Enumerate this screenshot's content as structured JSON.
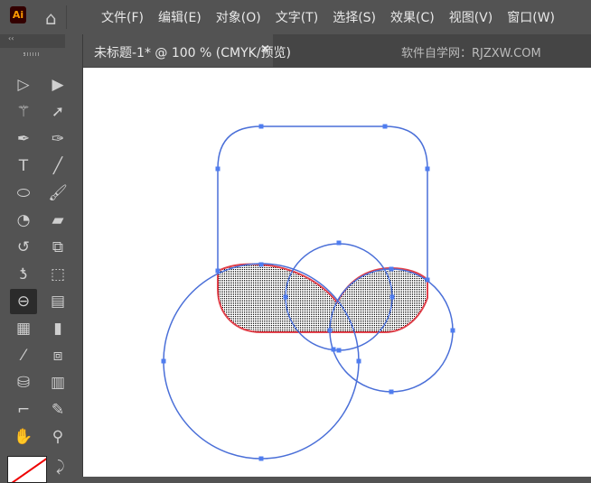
{
  "app": {
    "logo": "Ai",
    "home_icon": "home-icon"
  },
  "menus": [
    "文件(F)",
    "编辑(E)",
    "对象(O)",
    "文字(T)",
    "选择(S)",
    "效果(C)",
    "视图(V)",
    "窗口(W)"
  ],
  "document_tab": {
    "title": "未标题-1* @ 100 % (CMYK/预览)",
    "close": "×"
  },
  "watermark": "软件自学网：RJZXW.COM",
  "toolbar": {
    "collapse": "‹‹",
    "tools": [
      {
        "name": "selection-tool",
        "glyph": "▷"
      },
      {
        "name": "direct-selection-tool",
        "glyph": "▶"
      },
      {
        "name": "magic-wand-tool",
        "glyph": "⚚"
      },
      {
        "name": "lasso-tool",
        "glyph": "➚"
      },
      {
        "name": "pen-tool",
        "glyph": "✒"
      },
      {
        "name": "curvature-tool",
        "glyph": "✑"
      },
      {
        "name": "type-tool",
        "glyph": "T"
      },
      {
        "name": "line-tool",
        "glyph": "╱"
      },
      {
        "name": "ellipse-tool",
        "glyph": "⬭"
      },
      {
        "name": "paintbrush-tool",
        "glyph": "🖌"
      },
      {
        "name": "shaper-tool",
        "glyph": "◔"
      },
      {
        "name": "eraser-tool",
        "glyph": "▰"
      },
      {
        "name": "rotate-tool",
        "glyph": "↺"
      },
      {
        "name": "scale-tool",
        "glyph": "⧉"
      },
      {
        "name": "puppet-warp-tool",
        "glyph": "ƾ"
      },
      {
        "name": "free-transform-tool",
        "glyph": "⬚"
      },
      {
        "name": "shape-builder-tool",
        "glyph": "⊖"
      },
      {
        "name": "perspective-grid-tool",
        "glyph": "▤"
      },
      {
        "name": "mesh-tool",
        "glyph": "▦"
      },
      {
        "name": "gradient-tool",
        "glyph": "▮"
      },
      {
        "name": "eyedropper-tool",
        "glyph": "⁄"
      },
      {
        "name": "blend-tool",
        "glyph": "⧈"
      },
      {
        "name": "symbol-sprayer-tool",
        "glyph": "⛁"
      },
      {
        "name": "column-graph-tool",
        "glyph": "▥"
      },
      {
        "name": "artboard-tool",
        "glyph": "⌐"
      },
      {
        "name": "slice-tool",
        "glyph": "✎"
      },
      {
        "name": "hand-tool",
        "glyph": "✋"
      },
      {
        "name": "zoom-tool",
        "glyph": "⚲"
      }
    ],
    "swap": "⤸"
  },
  "colors": {
    "path": "#4a6fd8",
    "highlight": "#e0404a",
    "anchor": "#4f7df0"
  }
}
